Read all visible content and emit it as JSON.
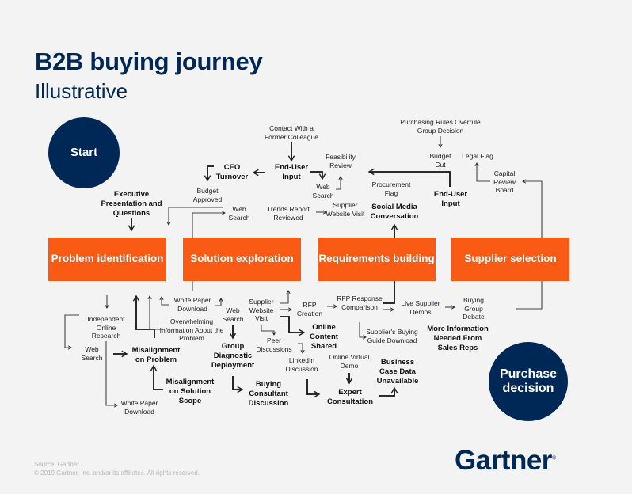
{
  "header": {
    "title": "B2B buying journey",
    "subtitle": "Illustrative"
  },
  "start": "Start",
  "end": "Purchase decision",
  "stages": [
    "Problem identification",
    "Solution exploration",
    "Requirements building",
    "Supplier selection"
  ],
  "colors": {
    "navy": "#002856",
    "orange": "#fa5b14",
    "background": "#f3f3f3"
  },
  "top_labels": [
    {
      "text": "Contact With a Former Colleague",
      "bold": false
    },
    {
      "text": "CEO Turnover",
      "bold": true
    },
    {
      "text": "End-User Input",
      "bold": true
    },
    {
      "text": "Feasibility Review",
      "bold": false
    },
    {
      "text": "Web Search",
      "bold": false
    },
    {
      "text": "Budget Approved",
      "bold": false
    },
    {
      "text": "Executive Presentation and Questions",
      "bold": true
    },
    {
      "text": "Web Search",
      "bold": false
    },
    {
      "text": "Trends Report Reviewed",
      "bold": false
    },
    {
      "text": "Supplier Website Visit",
      "bold": false
    },
    {
      "text": "Purchasing Rules Overrule Group Decision",
      "bold": false
    },
    {
      "text": "Budget Cut",
      "bold": false
    },
    {
      "text": "Legal Flag",
      "bold": false
    },
    {
      "text": "Capital Review Board",
      "bold": false
    },
    {
      "text": "Procurement Flag",
      "bold": false
    },
    {
      "text": "End-User Input",
      "bold": true
    },
    {
      "text": "Social Media Conversation",
      "bold": true
    }
  ],
  "bottom_labels": [
    {
      "text": "Independent Online Research",
      "bold": false
    },
    {
      "text": "Web Search",
      "bold": false
    },
    {
      "text": "White Paper Download",
      "bold": false
    },
    {
      "text": "Misalignment on Problem",
      "bold": true
    },
    {
      "text": "Misalignment on Solution Scope",
      "bold": true
    },
    {
      "text": "White Paper Download",
      "bold": false
    },
    {
      "text": "Overwhelming Information About the Problem",
      "bold": false
    },
    {
      "text": "Web Search",
      "bold": false
    },
    {
      "text": "Group Diagnostic Deployment",
      "bold": true
    },
    {
      "text": "Buying Consultant Discussion",
      "bold": true
    },
    {
      "text": "Supplier Website Visit",
      "bold": false
    },
    {
      "text": "Peer Discussions",
      "bold": false
    },
    {
      "text": "LinkedIn Discussion",
      "bold": false
    },
    {
      "text": "Online Content Shared",
      "bold": true
    },
    {
      "text": "RFP Creation",
      "bold": false
    },
    {
      "text": "RFP Response Comparison",
      "bold": false
    },
    {
      "text": "Supplier's Buying Guide Download",
      "bold": false
    },
    {
      "text": "Online Virtual Demo",
      "bold": false
    },
    {
      "text": "Expert Consultation",
      "bold": true
    },
    {
      "text": "Business Case Data Unavailable",
      "bold": true
    },
    {
      "text": "Live Supplier Demos",
      "bold": false
    },
    {
      "text": "Buying Group Debate",
      "bold": false
    },
    {
      "text": "More Information Needed From Sales Reps",
      "bold": true
    }
  ],
  "footer": {
    "source": "Source: Gartner",
    "copyright": "© 2019 Gartner, Inc. and/or its affiliates. All rights reserved."
  },
  "logo": {
    "text": "Gartner",
    "mark": "®"
  }
}
